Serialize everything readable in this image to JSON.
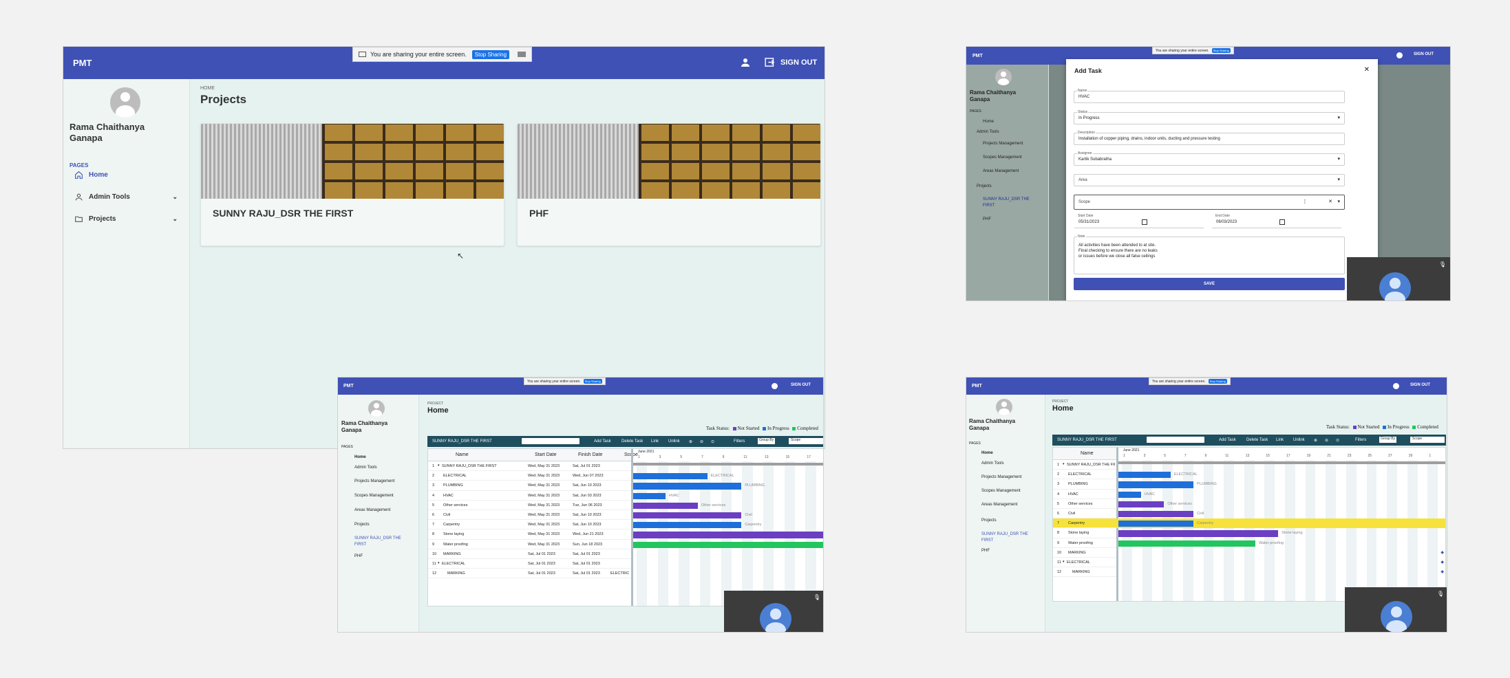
{
  "colors": {
    "appbar": "#3f51b5",
    "gantt_toolbar": "#1f4e5f",
    "not_started": "#6a3fc2",
    "in_progress": "#1e6fd9",
    "completed": "#22c55e",
    "highlight": "#f6e23a"
  },
  "share": {
    "text": "You are sharing your entire screen.",
    "stop": "Stop Sharing"
  },
  "appbar": {
    "brand": "PMT",
    "signout": "SIGN OUT",
    "user_icon": "person-icon",
    "signout_icon": "exit-icon"
  },
  "profile": {
    "name_line1": "Rama Chaithanya",
    "name_line2": "Ganapa",
    "name_full": "Rama Chaithanya Ganapa"
  },
  "nav": {
    "section": "PAGES",
    "home": "Home",
    "admin_tools": "Admin Tools",
    "projects": "Projects",
    "projects_management": "Projects Management",
    "scopes_management": "Scopes Management",
    "areas_management": "Areas Management",
    "project_a": "SUNNY RAJU_DSR THE FIRST",
    "project_b": "PHF"
  },
  "page1": {
    "breadcrumb": "HOME",
    "title": "Projects",
    "cards": [
      {
        "title": "SUNNY RAJU_DSR THE FIRST"
      },
      {
        "title": "PHF"
      }
    ]
  },
  "modal": {
    "title": "Add Task",
    "name_label": "Name",
    "name_value": "HVAC",
    "status_label": "Status",
    "status_value": "In Progress",
    "description_label": "Description",
    "description_value": "Installation of copper piping, drains, indoor units, ducting and pressure testing",
    "assignee_label": "Assignee",
    "assignee_value": "Kartik Subabratha",
    "area_placeholder": "Area",
    "scope_placeholder": "Scope",
    "start_label": "Start Date",
    "start_value": "05/31/2023",
    "end_label": "End Date",
    "end_value": "06/03/2023",
    "note_label": "Note",
    "note_line1": "All activities have been attended to at site.",
    "note_line2": "Final checking to ensure there are no leaks",
    "note_line3": "or issues before we close all false ceilings",
    "save": "SAVE"
  },
  "gantt_page": {
    "breadcrumb": "PROJECT",
    "title": "Home",
    "task_status_label": "Task Status:",
    "not_started": "Not Started",
    "in_progress": "In Progress",
    "completed": "Completed",
    "project": "SUNNY RAJU_DSR THE FIRST",
    "toolbar": {
      "add": "Add Task",
      "delete": "Delete Task",
      "link": "Link",
      "unlink": "Unlink",
      "filters": "Filters",
      "group_by": "Group By",
      "scope": "Scope"
    },
    "columns": {
      "name": "Name",
      "start": "Start Date",
      "finish": "Finish Date",
      "scope": "Scope"
    },
    "timeline_month": "June 2021",
    "timeline_days_a": [
      "1",
      "3",
      "5",
      "7",
      "9",
      "11",
      "13",
      "15",
      "17"
    ],
    "timeline_days_b": [
      "1",
      "3",
      "5",
      "7",
      "9",
      "11",
      "13",
      "15",
      "17",
      "19",
      "21",
      "23",
      "25",
      "27",
      "29",
      "1"
    ],
    "footer": "ELECTRIC",
    "rows": [
      {
        "id": "1",
        "name": "SUNNY RAJU_DSR THE FIRST",
        "start": "Wed, May 31 2023",
        "finish": "Sat, Jul 01 2023"
      },
      {
        "id": "2",
        "name": "ELECTRICAL",
        "start": "Wed, May 31 2023",
        "finish": "Wed, Jun 07 2023"
      },
      {
        "id": "3",
        "name": "PLUMBING",
        "start": "Wed, May 31 2023",
        "finish": "Sat, Jun 10 2023"
      },
      {
        "id": "4",
        "name": "HVAC",
        "start": "Wed, May 31 2023",
        "finish": "Sat, Jun 03 2023"
      },
      {
        "id": "5",
        "name": "Other services",
        "start": "Wed, May 31 2023",
        "finish": "Tue, Jun 06 2023"
      },
      {
        "id": "6",
        "name": "Civil",
        "start": "Wed, May 31 2023",
        "finish": "Sat, Jun 10 2023"
      },
      {
        "id": "7",
        "name": "Carpentry",
        "start": "Wed, May 31 2023",
        "finish": "Sat, Jun 10 2023"
      },
      {
        "id": "8",
        "name": "Stone laying",
        "start": "Wed, May 31 2023",
        "finish": "Wed, Jun 21 2023"
      },
      {
        "id": "9",
        "name": "Water proofing",
        "start": "Wed, May 31 2023",
        "finish": "Sun, Jun 18 2023"
      },
      {
        "id": "10",
        "name": "MARKING",
        "start": "Sat, Jul 01 2023",
        "finish": "Sat, Jul 01 2023"
      },
      {
        "id": "11",
        "name": "ELECTRICAL",
        "start": "Sat, Jul 01 2023",
        "finish": "Sat, Jul 01 2023"
      },
      {
        "id": "12",
        "name": "MARKING",
        "start": "Sat, Jul 01 2023",
        "finish": "Sat, Jul 01 2023"
      }
    ]
  }
}
